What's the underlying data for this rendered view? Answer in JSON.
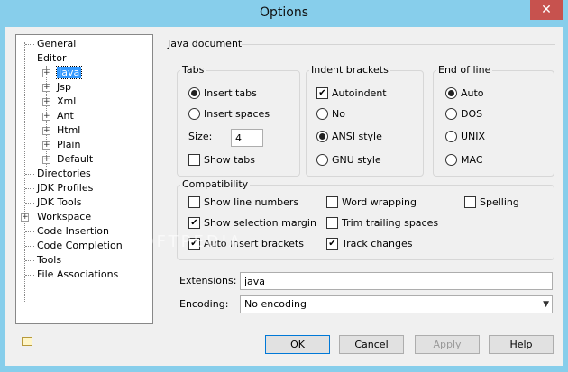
{
  "window": {
    "title": "Options",
    "close_glyph": "✕"
  },
  "tree": {
    "items": [
      {
        "label": "General"
      },
      {
        "label": "Editor"
      },
      {
        "label": "Java"
      },
      {
        "label": "Jsp"
      },
      {
        "label": "Xml"
      },
      {
        "label": "Ant"
      },
      {
        "label": "Html"
      },
      {
        "label": "Plain"
      },
      {
        "label": "Default"
      },
      {
        "label": "Directories"
      },
      {
        "label": "JDK Profiles"
      },
      {
        "label": "JDK Tools"
      },
      {
        "label": "Workspace"
      },
      {
        "label": "Code Insertion"
      },
      {
        "label": "Code Completion"
      },
      {
        "label": "Tools"
      },
      {
        "label": "File Associations"
      }
    ],
    "selected": "Java"
  },
  "section_title": "Java document",
  "tabs_group": {
    "title": "Tabs",
    "insert_tabs": "Insert tabs",
    "insert_spaces": "Insert spaces",
    "size_label": "Size:",
    "size_value": "4",
    "show_tabs": "Show tabs"
  },
  "indent_group": {
    "title": "Indent brackets",
    "autoindent": "Autoindent",
    "no": "No",
    "ansi": "ANSI style",
    "gnu": "GNU style"
  },
  "eol_group": {
    "title": "End of line",
    "auto": "Auto",
    "dos": "DOS",
    "unix": "UNIX",
    "mac": "MAC"
  },
  "compat_group": {
    "title": "Compatibility",
    "show_line_numbers": "Show line numbers",
    "word_wrapping": "Word wrapping",
    "spelling": "Spelling",
    "show_selection_margin": "Show selection margin",
    "trim_trailing_spaces": "Trim trailing spaces",
    "auto_insert_brackets": "Auto insert brackets",
    "track_changes": "Track changes"
  },
  "extensions": {
    "label": "Extensions:",
    "value": "java"
  },
  "encoding": {
    "label": "Encoding:",
    "value": "No encoding"
  },
  "buttons": {
    "ok": "OK",
    "cancel": "Cancel",
    "apply": "Apply",
    "help": "Help"
  },
  "check_glyph": "✔",
  "watermark": "SOFTPEDIA"
}
